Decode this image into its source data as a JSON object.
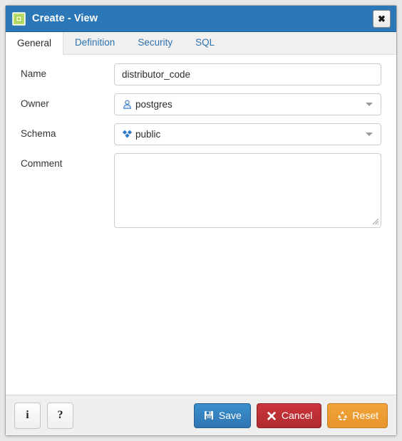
{
  "window": {
    "title": "Create - View",
    "icon": "view-object-icon",
    "close_label": "✖",
    "close_icon": "close-icon",
    "titlebar_color": "#2c77b8"
  },
  "tabs": [
    {
      "label": "General",
      "active": true
    },
    {
      "label": "Definition",
      "active": false
    },
    {
      "label": "Security",
      "active": false
    },
    {
      "label": "SQL",
      "active": false
    }
  ],
  "form": {
    "name": {
      "label": "Name",
      "value": "distributor_code",
      "placeholder": ""
    },
    "owner": {
      "label": "Owner",
      "value": "postgres",
      "icon": "user-icon",
      "icon_color": "#3a7cc4"
    },
    "schema": {
      "label": "Schema",
      "value": "public",
      "icon": "schema-icon",
      "icon_color": "#1f6fc4"
    },
    "comment": {
      "label": "Comment",
      "value": "",
      "placeholder": ""
    }
  },
  "footer": {
    "info_label": "i",
    "info_icon": "info-icon",
    "help_label": "?",
    "help_icon": "help-icon",
    "save_label": "Save",
    "save_icon": "floppy-disk-icon",
    "save_color": "#2f75b1",
    "cancel_label": "Cancel",
    "cancel_icon": "x-mark-icon",
    "cancel_color": "#b02b30",
    "reset_label": "Reset",
    "reset_icon": "recycle-icon",
    "reset_color": "#e8952b"
  }
}
